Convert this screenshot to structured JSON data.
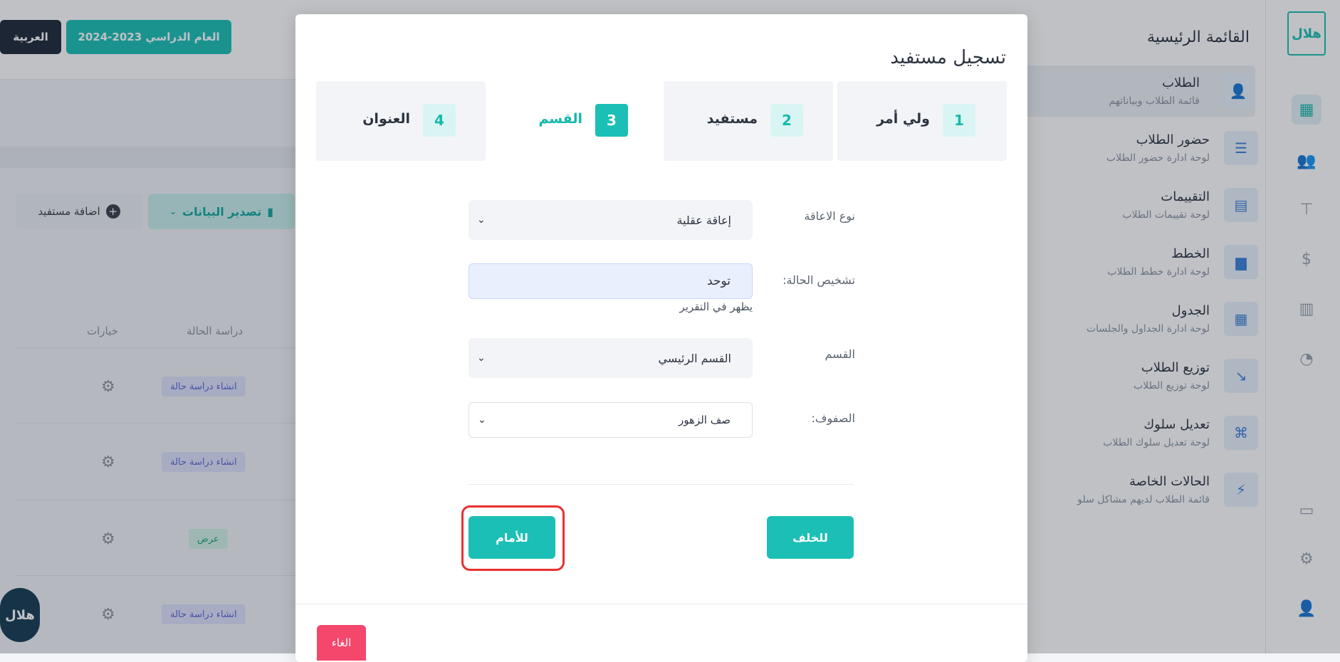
{
  "rail": {
    "logo": "هلال",
    "icons": [
      "dashboard-icon",
      "users-icon",
      "tie-icon",
      "dollar-icon",
      "building-icon",
      "pie-icon",
      "chat-icon",
      "gear-icon",
      "user-icon"
    ]
  },
  "sidebar": {
    "title": "القائمة الرئيسية",
    "items": [
      {
        "title": "الطلاب",
        "sub": "قائمة الطلاب وبياناتهم",
        "icon": "student-icon"
      },
      {
        "title": "حضور الطلاب",
        "sub": "لوحة ادارة حضور الطلاب",
        "icon": "list-icon"
      },
      {
        "title": "التقييمات",
        "sub": "لوحة تقييمات الطلاب",
        "icon": "layout-icon"
      },
      {
        "title": "الخطط",
        "sub": "لوحة ادارة خطط الطلاب",
        "icon": "document-icon"
      },
      {
        "title": "الجدول",
        "sub": "لوحة ادارة الجداول والجلسات",
        "icon": "grid-icon"
      },
      {
        "title": "توزيع الطلاب",
        "sub": "لوحة توزيع الطلاب",
        "icon": "split-icon"
      },
      {
        "title": "تعديل سلوك",
        "sub": "لوحة تعديل سلوك الطلاب",
        "icon": "command-icon"
      },
      {
        "title": "الحالات الخاصة",
        "sub": "قائمة الطلاب لديهم مشاكل سلو",
        "icon": "bolt-icon"
      }
    ]
  },
  "topbar": {
    "language": "العربية",
    "year": "العام الدراسي 2023-2024"
  },
  "toolbar": {
    "add_label": "اضافة مستفيد",
    "export_label": "تصدير البيانات"
  },
  "table": {
    "headers": {
      "case_study": "دراسة الحالة",
      "options": "خيارات"
    },
    "rows": [
      {
        "badge": "انشاء دراسة حالة",
        "type": "create"
      },
      {
        "badge": "انشاء دراسة حالة",
        "type": "create"
      },
      {
        "badge": "عرض",
        "type": "view"
      },
      {
        "badge": "انشاء دراسة حالة",
        "type": "create"
      }
    ]
  },
  "modal": {
    "title": "تسجيل مستفيد",
    "steps": [
      {
        "num": "1",
        "label": "ولي أمر"
      },
      {
        "num": "2",
        "label": "مستفيد"
      },
      {
        "num": "3",
        "label": "القسم"
      },
      {
        "num": "4",
        "label": "العنوان"
      }
    ],
    "fields": {
      "disability_label": "نوع الاعاقة",
      "disability_value": "إعاقة عقلية",
      "diagnosis_label": "تشخيص الحالة:",
      "diagnosis_value": "توحد",
      "diagnosis_hint": "يظهر في التقرير",
      "department_label": "القسم",
      "department_value": "القسم الرئيسي",
      "classes_label": "الصفوف:",
      "classes_value": "صف الزهور"
    },
    "buttons": {
      "back": "للخلف",
      "next": "للأمام",
      "cancel": "الغاء"
    }
  },
  "colors": {
    "accent": "#1bbfb5",
    "danger": "#f4476b",
    "highlight": "#ea2f2f"
  }
}
